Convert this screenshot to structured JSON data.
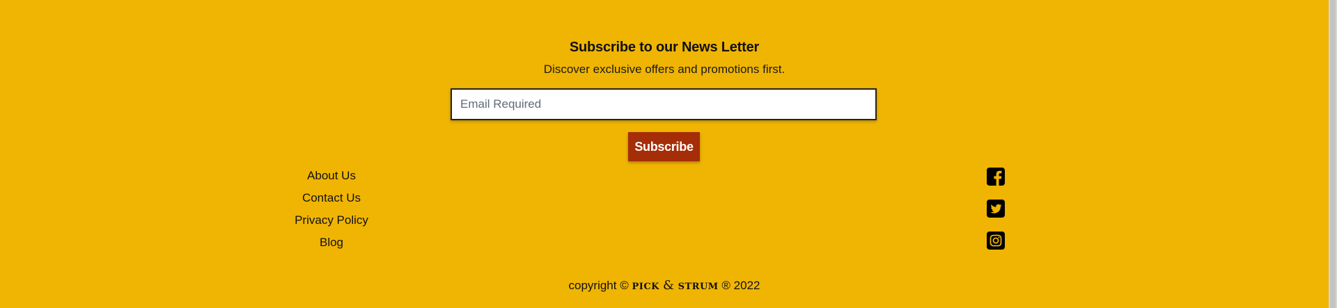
{
  "newsletter": {
    "title": "Subscribe to our News Letter",
    "subtitle": "Discover exclusive offers and promotions first.",
    "email_placeholder": "Email Required",
    "email_value": "",
    "subscribe_label": "Subscribe"
  },
  "footer_links": [
    {
      "label": "About Us"
    },
    {
      "label": "Contact Us"
    },
    {
      "label": "Privacy Policy"
    },
    {
      "label": "Blog"
    }
  ],
  "social": [
    {
      "icon": "facebook-icon"
    },
    {
      "icon": "twitter-icon"
    },
    {
      "icon": "instagram-icon"
    }
  ],
  "copyright": {
    "prefix": "copyright ©",
    "brand_first": "PICK",
    "brand_amp": "&",
    "brand_second": "STRUM",
    "suffix": "® 2022"
  },
  "colors": {
    "background": "#f0b503",
    "button": "#a52d08",
    "button_text": "#ffffff",
    "text": "#111111"
  }
}
